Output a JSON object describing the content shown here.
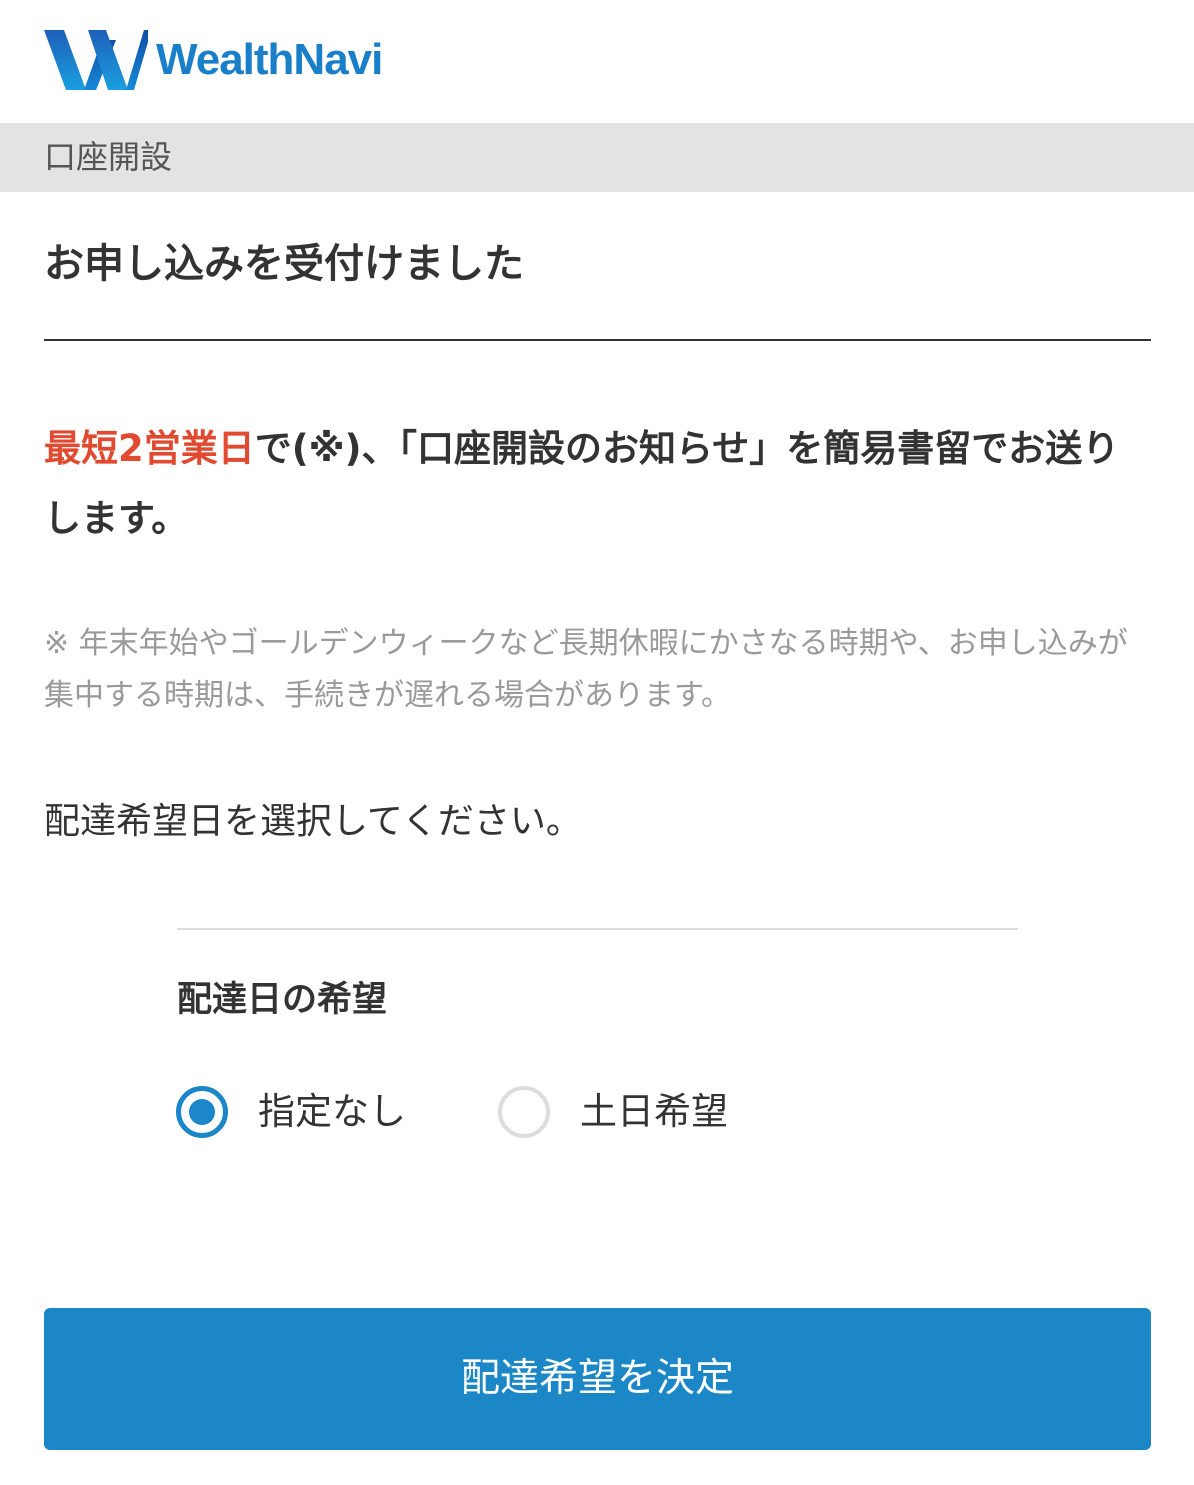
{
  "header": {
    "logo_text": "WealthNavi",
    "logo_icon": "wealthnavi-w-logo",
    "brand_color": "#1a7fc9"
  },
  "breadcrumb": {
    "label": "口座開設"
  },
  "main": {
    "title": "お申し込みを受付けました",
    "lead": {
      "accent_text": "最短2営業日",
      "rest_text": "で(※)、「口座開設のお知らせ」を簡易書留でお送りします。",
      "accent_color": "#e04a30"
    },
    "note": "※ 年末年始やゴールデンウィークなど長期休暇にかさなる時期や、お申し込みが集中する時期は、手続きが遅れる場合があります。",
    "instruction": "配達希望日を選択してください。"
  },
  "delivery": {
    "section_label": "配達日の希望",
    "options": [
      {
        "label": "指定なし",
        "checked": true
      },
      {
        "label": "土日希望",
        "checked": false
      }
    ]
  },
  "actions": {
    "submit_label": "配達希望を決定",
    "button_color": "#1b87c6"
  }
}
